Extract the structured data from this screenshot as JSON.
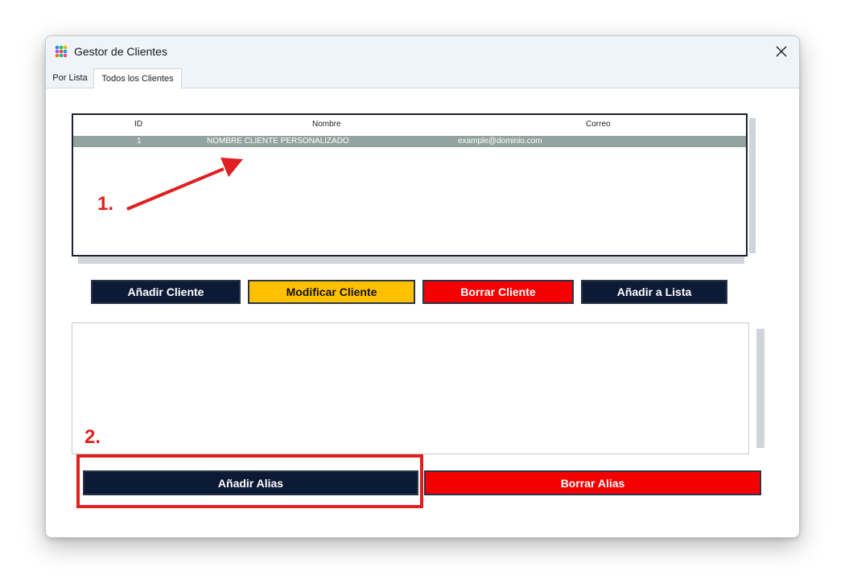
{
  "window": {
    "title": "Gestor de Clientes"
  },
  "tabs": [
    {
      "label": "Por Lista",
      "active": false
    },
    {
      "label": "Todos los Clientes",
      "active": true
    }
  ],
  "table": {
    "columns": [
      "ID",
      "Nombre",
      "Correo"
    ],
    "rows": [
      {
        "id": "1",
        "nombre": "NOMBRE CLIENTE PERSONALIZADO",
        "correo": "example@dominio.com",
        "selected": true
      }
    ]
  },
  "buttons": {
    "add_client": "Añadir Cliente",
    "modify_client": "Modificar Cliente",
    "delete_client": "Borrar Cliente",
    "add_to_list": "Añadir a Lista",
    "add_alias": "Añadir Alias",
    "delete_alias": "Borrar Alias"
  },
  "annotations": {
    "step1": "1.",
    "step2": "2."
  },
  "colors": {
    "dark": "#0d1a36",
    "yellow": "#ffc000",
    "red": "#f50000",
    "selected_row": "#93a39f",
    "annotation": "#e02020"
  },
  "icons": [
    "app-icon",
    "close-icon",
    "arrow-annotation-icon"
  ]
}
